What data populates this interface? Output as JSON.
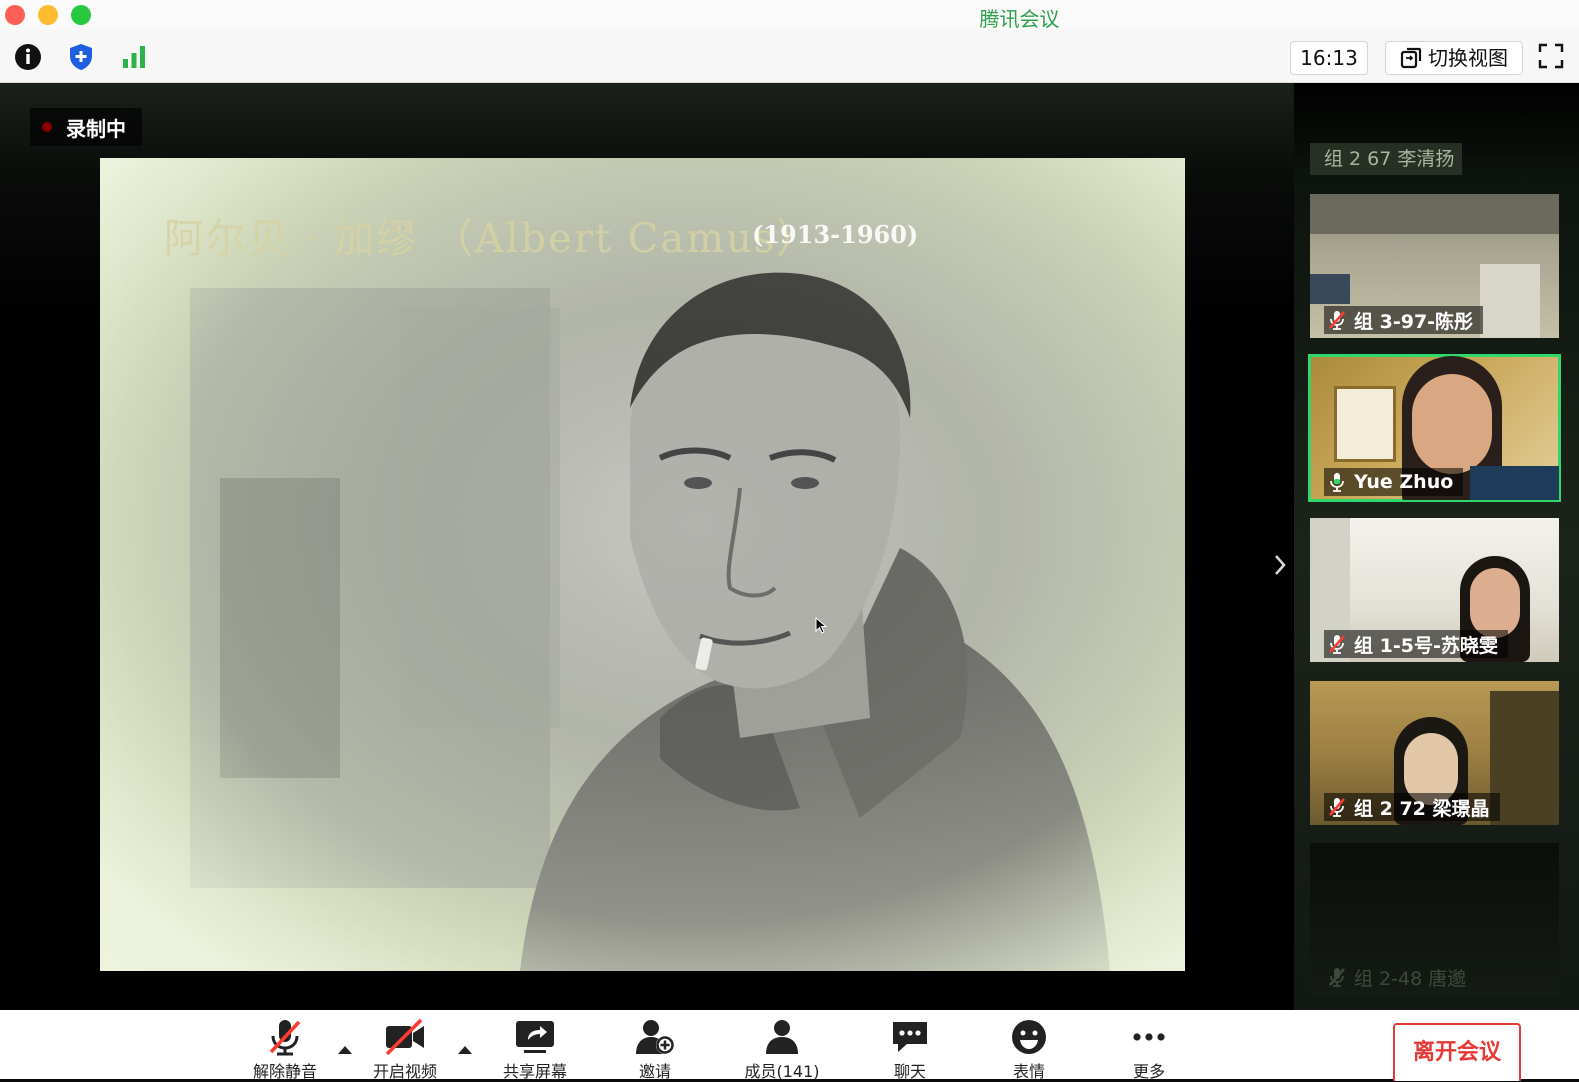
{
  "window": {
    "title": "腾讯会议"
  },
  "toolbar": {
    "time": "16:13",
    "switch_view_label": "切换视图"
  },
  "recording": {
    "label": "录制中"
  },
  "slide": {
    "title": "阿尔贝 · 加缪 （Albert Camus）",
    "years": "(1913-1960)"
  },
  "sidebar": {
    "group_label": "组 2 67 李清扬",
    "participants": [
      {
        "name": "组 3-97-陈彤",
        "muted": true
      },
      {
        "name": "Yue Zhuo",
        "muted": false,
        "speaking": true
      },
      {
        "name": "组 1-5号-苏晓雯",
        "muted": true
      },
      {
        "name": "组 2 72 梁璟晶",
        "muted": true
      },
      {
        "name": "组 2-48 唐邈",
        "muted": true
      }
    ]
  },
  "bottombar": {
    "unmute": "解除静音",
    "start_video": "开启视频",
    "share_screen": "共享屏幕",
    "invite": "邀请",
    "members": "成员(141)",
    "chat": "聊天",
    "reactions": "表情",
    "more": "更多",
    "leave": "离开会议"
  },
  "colors": {
    "accent_green": "#2fd86b",
    "leave_red": "#e53935",
    "title_green": "#2f9e4a"
  }
}
